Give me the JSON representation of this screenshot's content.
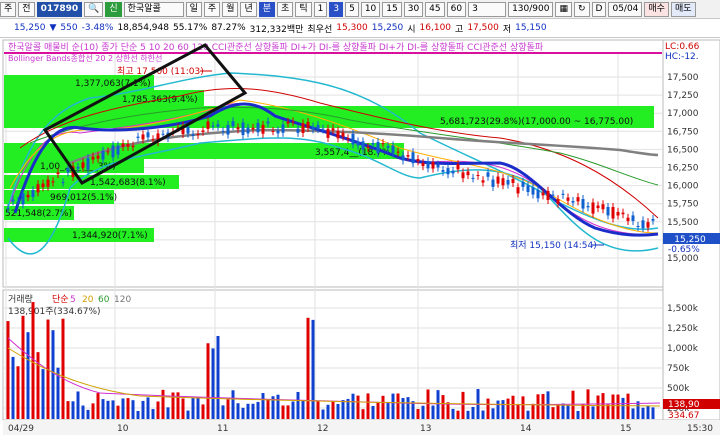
{
  "toolbar": {
    "tab_label": "주",
    "period_label": "전",
    "code": "017890",
    "stock_badge": "신",
    "stock_name": "한국알콜",
    "periods": [
      "일",
      "주",
      "월",
      "년",
      "분",
      "초",
      "틱"
    ],
    "selected_period": "분",
    "intervals": [
      "1",
      "3",
      "5",
      "10",
      "15",
      "30",
      "45",
      "60"
    ],
    "selected_interval": "3",
    "interval_value": "3",
    "count": "130/900",
    "d_checkbox": "D",
    "date": "05/04",
    "buy_label": "매수",
    "sell_label": "매도"
  },
  "quote": {
    "price": "15,250",
    "change": "550",
    "change_pct": "-3.48%",
    "volume": "18,854,948",
    "ratio": "55.17%",
    "ratio2": "87.27%",
    "amount": "312,332백만",
    "best_ask_label": "최우선",
    "best_ask": "15,300",
    "best_bid": "15,250",
    "open_label": "시",
    "open": "16,100",
    "high_label": "고",
    "high": "17,500",
    "low_label": "저",
    "low": "15,150"
  },
  "legend_row": "한국알콜 매물비 순(10)  종가 단순 5 10 20 60 120  CCI관준선 상향돌파  DI+가 DI-를 상향돌파  DI+가 DI-를 상향돌파  CCI관준선 상향돌파",
  "bb_label": "Bollinger Bands종합선 20 2 상한선 하한선",
  "right_labels": {
    "lc": "LC:0.66",
    "hc": "HC:-12."
  },
  "annotations": {
    "high": "최고 17,500 (11:03)",
    "low": "최저 15,150 (14:54)",
    "vol_label": "138,901주(334.67%)"
  },
  "volume_profile": [
    {
      "label": "1,377,063(7.1%)",
      "value": 1377063
    },
    {
      "label": "1,785,363(9.4%)",
      "value": 1785363
    },
    {
      "label": "5,681,723(29.8%)(17,000.00 ~ 16,775.00)",
      "value": 5681723
    },
    {
      "label": "3,557,4__(18.7%)",
      "value": 3557400
    },
    {
      "label": "1,00_,___(___3%)",
      "value": 1000000
    },
    {
      "label": "1,542,683(8.1%)",
      "value": 1542683
    },
    {
      "label": "969,012(5.1%)",
      "value": 969012
    },
    {
      "label": "521,548(2.7%)",
      "value": 521548
    },
    {
      "label": "1,344,920(7.1%)",
      "value": 1344920
    }
  ],
  "price_axis": [
    "17,500",
    "17,250",
    "17,000",
    "16,750",
    "16,500",
    "16,250",
    "16,000",
    "15,750",
    "15,500",
    "15,250",
    "15,000"
  ],
  "price_badges": {
    "current": "15,250",
    "pct": "-0.65%"
  },
  "volume_axis": [
    "1,500k",
    "1,250k",
    "1,000k",
    "750k",
    "500k",
    "250k"
  ],
  "volume_badges": {
    "vol": "138,90",
    "pct": "334.67"
  },
  "volume_legend": {
    "title": "거래량",
    "ma_type": "단순",
    "periods": [
      "5",
      "20",
      "60",
      "120"
    ]
  },
  "x_axis": [
    "04/29",
    "10",
    "11",
    "12",
    "13",
    "14",
    "15"
  ],
  "time_label": "15:30"
}
